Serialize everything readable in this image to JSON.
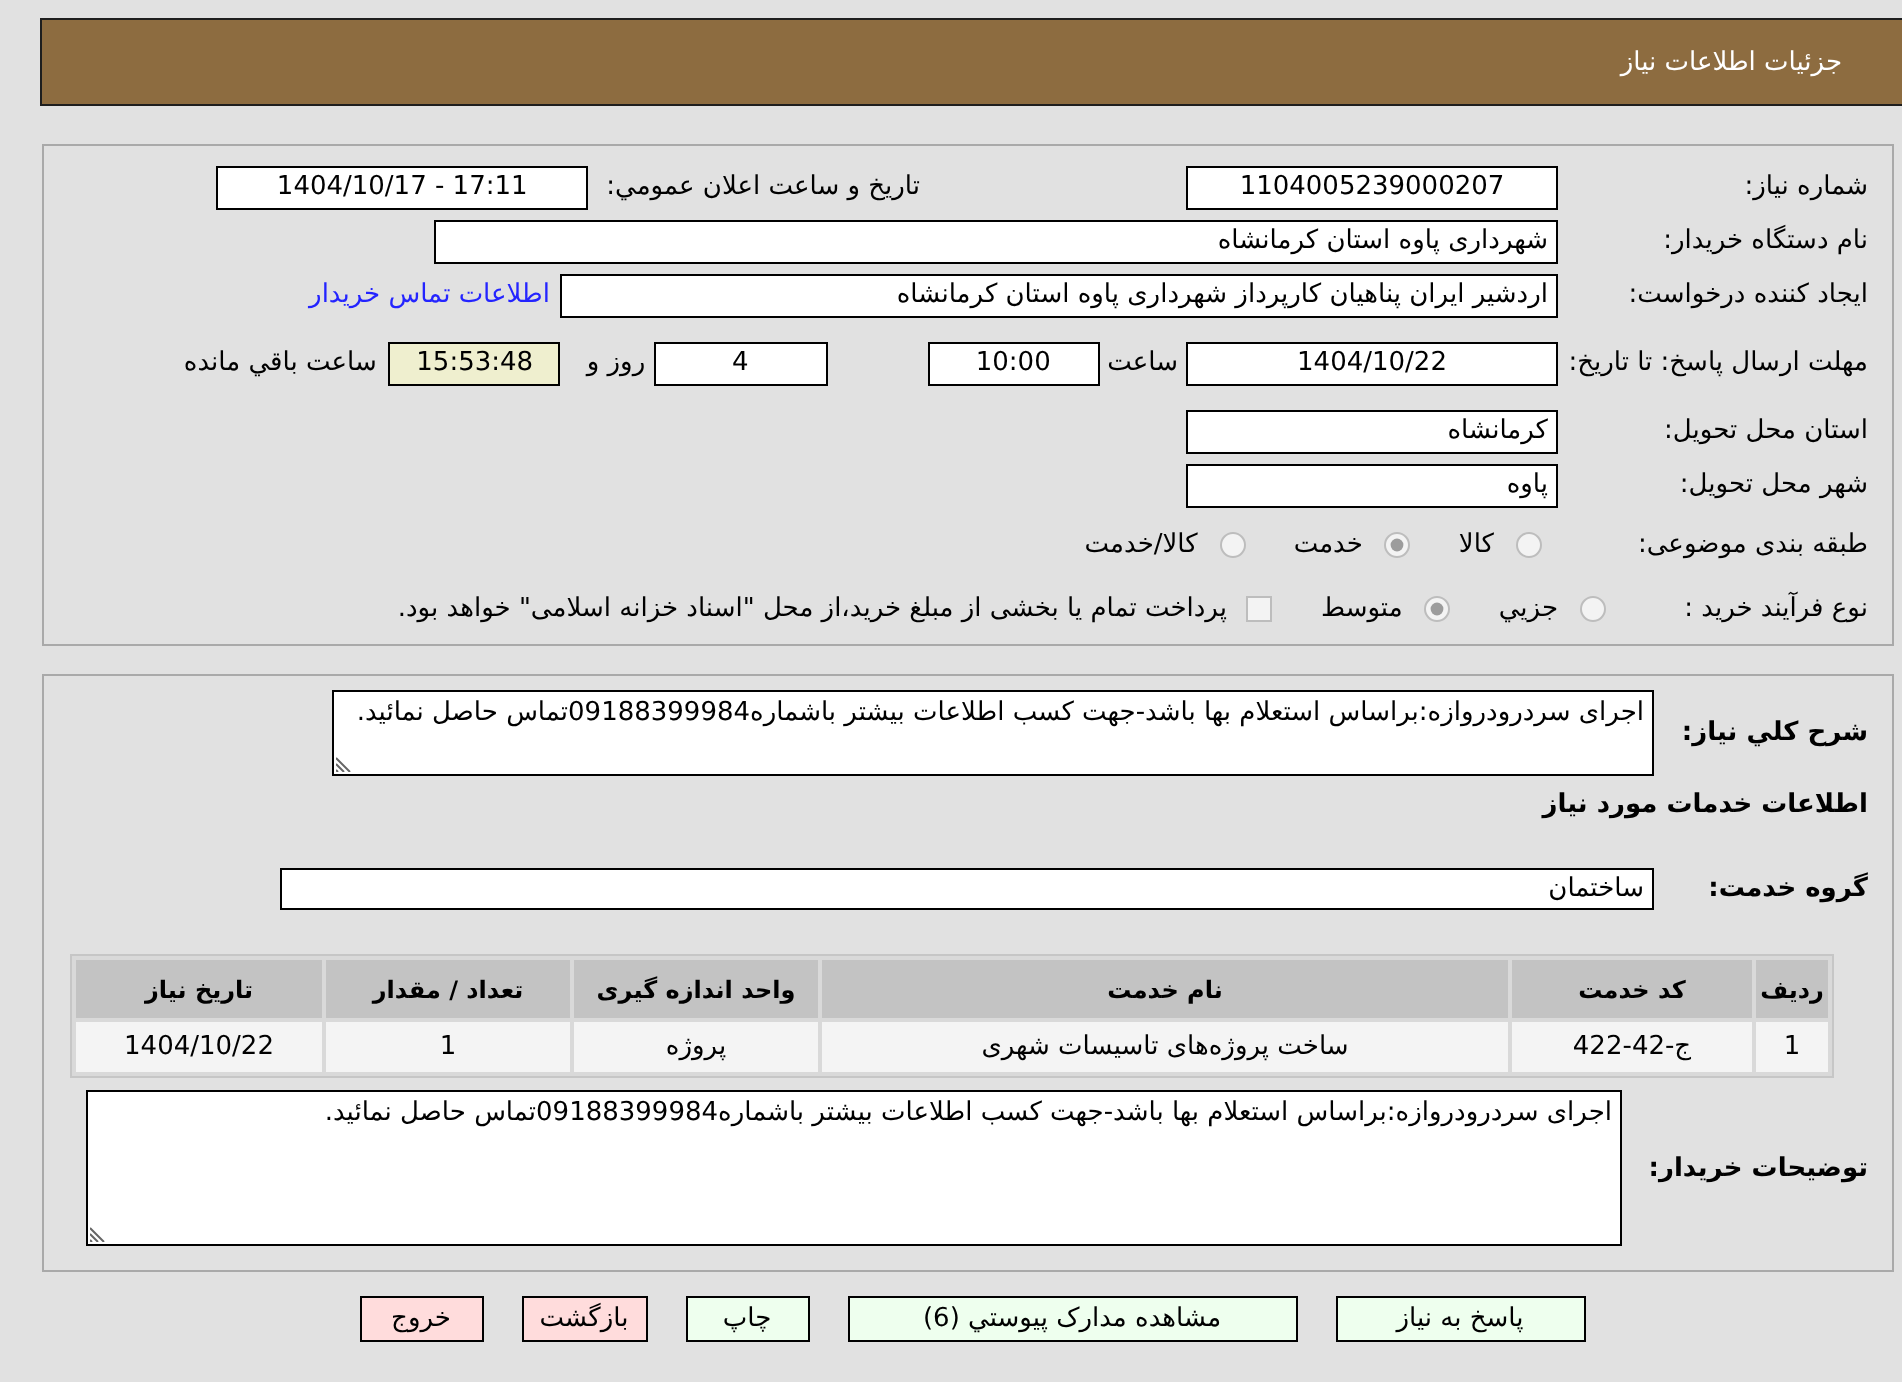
{
  "header": {
    "title": "جزئیات اطلاعات نیاز"
  },
  "details": {
    "need_number": {
      "label": "شماره نیاز:",
      "value": "1104005239000207"
    },
    "announcement": {
      "label": "تاریخ و ساعت اعلان عمومي:",
      "value": "1404/10/17 - 17:11"
    },
    "buyer_org": {
      "label": "نام دستگاه خریدار:",
      "value": "شهرداری پاوه استان کرمانشاه"
    },
    "requester": {
      "label": "ایجاد کننده درخواست:",
      "value": "اردشیر ایران پناهیان کارپرداز شهرداری پاوه استان کرمانشاه",
      "link": "اطلاعات تماس خریدار"
    },
    "deadline": {
      "label": "مهلت ارسال پاسخ: تا تاریخ:",
      "date": "1404/10/22",
      "time_label": "ساعت",
      "time": "10:00",
      "days": "4",
      "days_label": "روز و",
      "remaining": "15:53:48",
      "remaining_label": "ساعت باقي مانده"
    },
    "province": {
      "label": "استان محل تحویل:",
      "value": "کرمانشاه"
    },
    "city": {
      "label": "شهر محل تحویل:",
      "value": "پاوه"
    },
    "category": {
      "label": "طبقه بندی موضوعی:",
      "options": [
        {
          "label": "کالا",
          "selected": false
        },
        {
          "label": "خدمت",
          "selected": true
        },
        {
          "label": "کالا/خدمت",
          "selected": false
        }
      ]
    },
    "process": {
      "label": "نوع فرآیند خرید :",
      "options": [
        {
          "label": "جزيي",
          "selected": false
        },
        {
          "label": "متوسط",
          "selected": true
        }
      ],
      "treasury": {
        "label": "پرداخت تمام یا بخشی از مبلغ خرید،از محل \"اسناد خزانه اسلامی\" خواهد بود.",
        "checked": false
      }
    }
  },
  "need": {
    "description": {
      "label": "شرح کلي نیاز:",
      "value": "اجرای سردرودروازه:براساس استعلام بها باشد-جهت کسب اطلاعات بیشتر باشماره09188399984تماس حاصل نمائید."
    },
    "services_heading": "اطلاعات خدمات مورد نیاز",
    "service_group": {
      "label": "گروه خدمت:",
      "value": "ساختمان"
    },
    "table": {
      "columns": [
        "ردیف",
        "کد خدمت",
        "نام خدمت",
        "واحد اندازه گیری",
        "تعداد / مقدار",
        "تاریخ نیاز"
      ],
      "rows": [
        [
          "1",
          "ج-42-422",
          "ساخت پروژه‌های تاسیسات شهری",
          "پروژه",
          "1",
          "1404/10/22"
        ]
      ]
    },
    "buyer_notes": {
      "label": "توضیحات خریدار:",
      "value": "اجرای سردرودروازه:براساس استعلام بها باشد-جهت کسب اطلاعات بیشتر باشماره09188399984تماس حاصل نمائید."
    }
  },
  "buttons": [
    {
      "label": "پاسخ به نیاز",
      "kind": "action"
    },
    {
      "label": "مشاهده مدارک پیوستي (6)",
      "kind": "action"
    },
    {
      "label": "چاپ",
      "kind": "action"
    },
    {
      "label": "بازگشت",
      "kind": "exit"
    },
    {
      "label": "خروج",
      "kind": "exit"
    }
  ]
}
